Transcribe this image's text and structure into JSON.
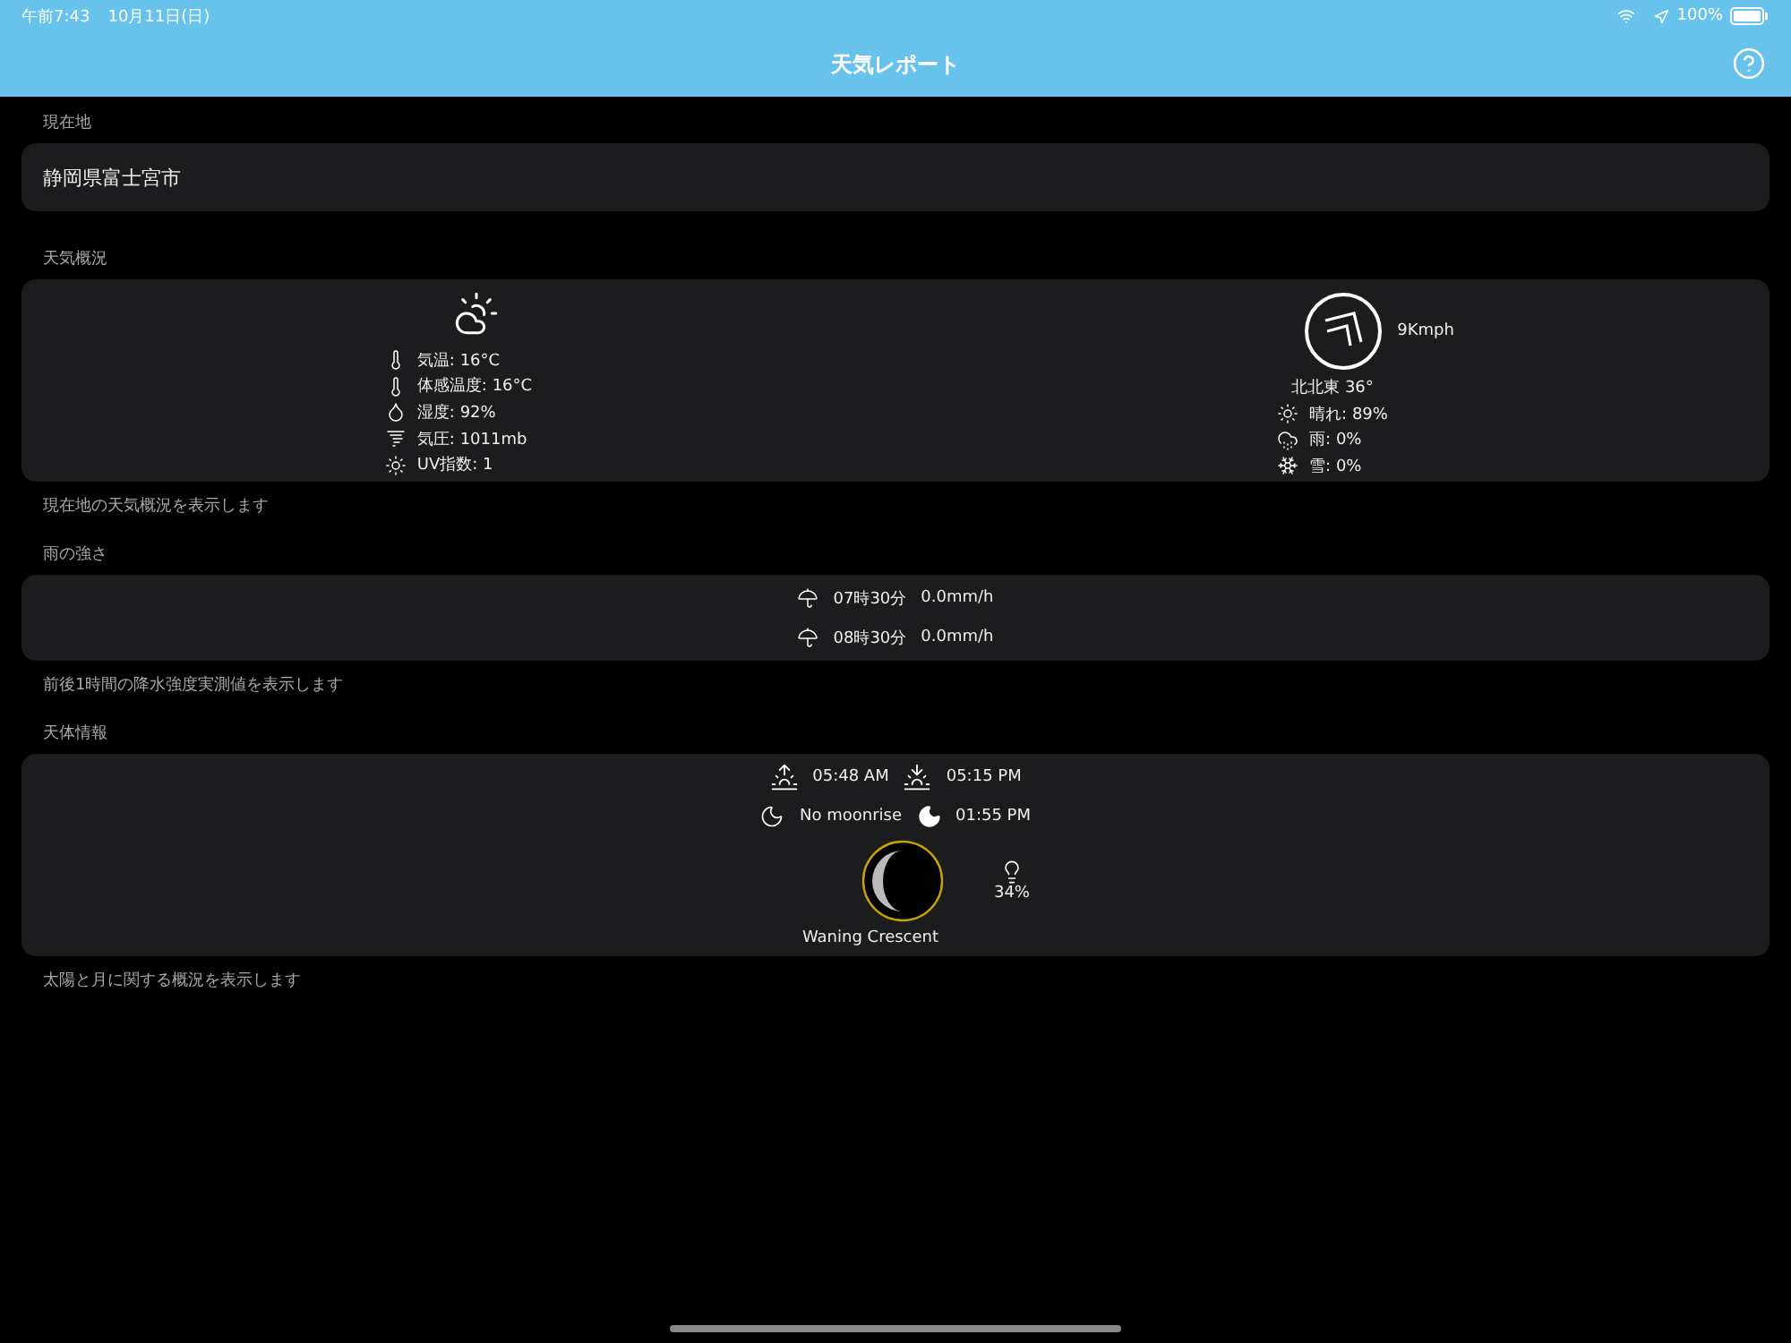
{
  "status_bar": {
    "time": "午前7:43",
    "date": "10月11日(日)",
    "battery": "100%"
  },
  "nav_bar": {
    "title": "天気レポート"
  },
  "location": {
    "label": "現在地",
    "value": "静岡県富士宮市"
  },
  "overview": {
    "label": "天気概況",
    "left": [
      {
        "kind": "temp",
        "text": "気温: 16°C"
      },
      {
        "kind": "temp",
        "text": "体感温度: 16°C"
      },
      {
        "kind": "humidity",
        "text": "湿度: 92%"
      },
      {
        "kind": "pressure",
        "text": "気圧: 1011mb"
      },
      {
        "kind": "sun",
        "text": "UV指数: 1"
      }
    ],
    "wind_speed": "9Kmph",
    "wind_direction": "北北東 36°",
    "right": [
      {
        "kind": "sun",
        "text": "晴れ: 89%"
      },
      {
        "kind": "rain",
        "text": "雨: 0%"
      },
      {
        "kind": "snow",
        "text": "雪: 0%"
      }
    ],
    "note": "現在地の天気概況を表示します"
  },
  "rain": {
    "label": "雨の強さ",
    "rows": [
      {
        "time": "07時30分",
        "value": "0.0mm/h"
      },
      {
        "time": "08時30分",
        "value": "0.0mm/h"
      }
    ],
    "note": "前後1時間の降水強度実測値を表示します"
  },
  "astronomy": {
    "label": "天体情報",
    "sunrise": "05:48 AM",
    "sunset": "05:15 PM",
    "moonrise": "No moonrise",
    "moonset": "01:55 PM",
    "illumination": "34%",
    "phase": "Waning Crescent",
    "note": "太陽と月に関する概況を表示します"
  }
}
